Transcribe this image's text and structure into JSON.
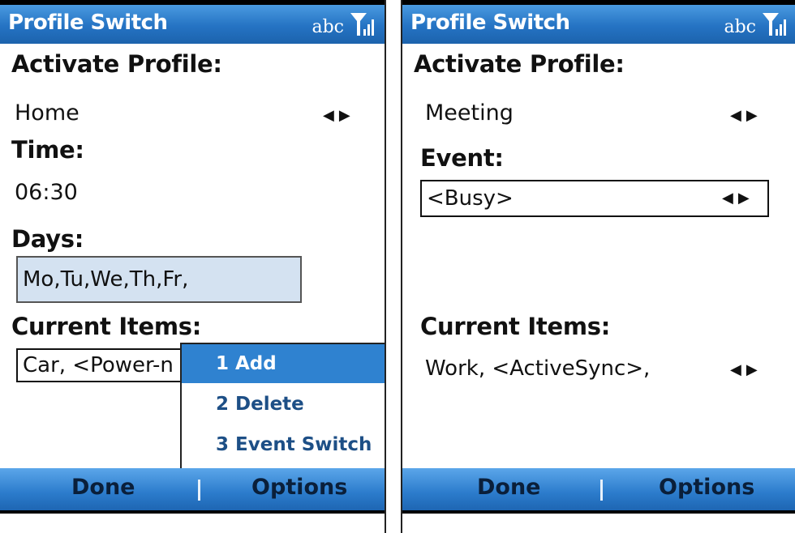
{
  "left": {
    "title": "Profile Switch",
    "input_mode": "abc",
    "activate_label": "Activate Profile:",
    "activate_value": "Home",
    "time_label": "Time:",
    "time_value": "06:30",
    "days_label": "Days:",
    "days_value": "Mo,Tu,We,Th,Fr,",
    "current_label": "Current Items:",
    "current_value": "Car, <Power-n",
    "menu": [
      "1 Add",
      "2 Delete",
      "3 Event Switch"
    ],
    "softkey_left": "Done",
    "softkey_right": "Options"
  },
  "right": {
    "title": "Profile Switch",
    "input_mode": "abc",
    "activate_label": "Activate Profile:",
    "activate_value": "Meeting",
    "event_label": "Event:",
    "event_value": "<Busy>",
    "current_label": "Current Items:",
    "current_value": "Work, <ActiveSync>,",
    "softkey_left": "Done",
    "softkey_right": "Options"
  },
  "icons": {
    "signal": "signal-strength-icon",
    "arrows": "left-right-arrows-icon"
  },
  "colors": {
    "titlebar": "#2573c3",
    "selected_menu": "#2f82d0",
    "selected_field": "#d4e2f1"
  }
}
